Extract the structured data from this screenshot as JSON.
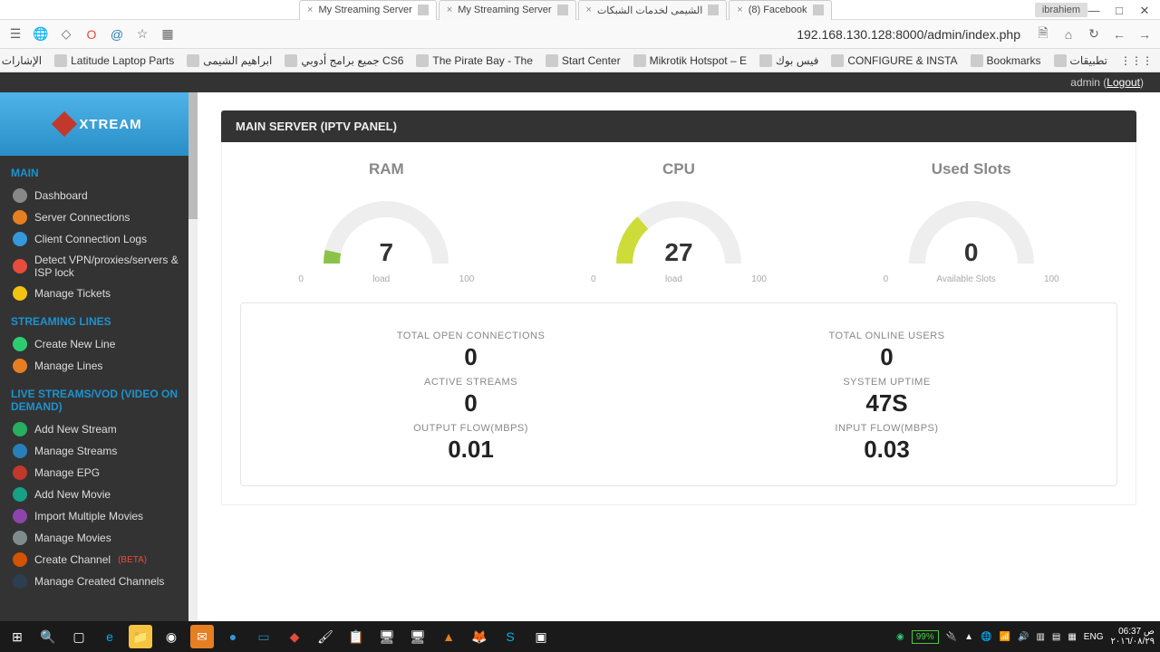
{
  "window": {
    "user_badge": "ibrahiem",
    "tabs": [
      {
        "title": "My Streaming Server",
        "active": true
      },
      {
        "title": "My Streaming Server",
        "active": false
      },
      {
        "title": "الشيمى لخدمات الشبكات",
        "active": false
      },
      {
        "title": "(8) Facebook",
        "active": false
      }
    ]
  },
  "browser": {
    "url": "192.168.130.128:8000/admin/index.php"
  },
  "bookmarks": [
    "تطبيقات",
    "Bookmarks",
    "CONFIGURE & INSTA",
    "فيس بوك",
    "Mikrotik Hotspot – E",
    "Start Center",
    "The Pirate Bay - The",
    "جميع برامج أدوبي CS6",
    "ابراهيم الشيمى",
    "Latitude Laptop Parts",
    "الإشارات الأخرى"
  ],
  "adminbar": {
    "user": "admin",
    "logout": "Logout"
  },
  "sidebar": {
    "logo": "XTREAM",
    "sections": [
      {
        "title": "MAIN",
        "items": [
          {
            "label": "Dashboard",
            "ic": "#888"
          },
          {
            "label": "Server Connections",
            "ic": "#e67e22"
          },
          {
            "label": "Client Connection Logs",
            "ic": "#3498db"
          },
          {
            "label": "Detect VPN/proxies/servers & ISP lock",
            "ic": "#e74c3c"
          },
          {
            "label": "Manage Tickets",
            "ic": "#f1c40f"
          }
        ]
      },
      {
        "title": "STREAMING LINES",
        "items": [
          {
            "label": "Create New Line",
            "ic": "#2ecc71"
          },
          {
            "label": "Manage Lines",
            "ic": "#e67e22"
          }
        ]
      },
      {
        "title": "LIVE STREAMS/VOD (VIDEO ON DEMAND)",
        "items": [
          {
            "label": "Add New Stream",
            "ic": "#27ae60"
          },
          {
            "label": "Manage Streams",
            "ic": "#2980b9"
          },
          {
            "label": "Manage EPG",
            "ic": "#c0392b"
          },
          {
            "label": "Add New Movie",
            "ic": "#16a085"
          },
          {
            "label": "Import Multiple Movies",
            "ic": "#8e44ad"
          },
          {
            "label": "Manage Movies",
            "ic": "#7f8c8d"
          },
          {
            "label": "Create Channel",
            "ic": "#d35400",
            "beta": "(BETA)"
          },
          {
            "label": "Manage Created Channels",
            "ic": "#2c3e50"
          }
        ]
      }
    ]
  },
  "panel": {
    "title": "MAIN SERVER (IPTV PANEL)",
    "gauges": [
      {
        "title": "RAM",
        "value": "7",
        "sub": "load",
        "min": "0",
        "max": "100",
        "pct": 7,
        "color": "#8bc34a"
      },
      {
        "title": "CPU",
        "value": "27",
        "sub": "load",
        "min": "0",
        "max": "100",
        "pct": 27,
        "color": "#cddc39"
      },
      {
        "title": "Used Slots",
        "value": "0",
        "sub": "Available Slots",
        "min": "0",
        "max": "100",
        "pct": 0,
        "color": "#eee"
      }
    ],
    "stats_left": [
      {
        "label": "TOTAL OPEN CONNECTIONS",
        "val": "0"
      },
      {
        "label": "ACTIVE STREAMS",
        "val": "0"
      },
      {
        "label": "OUTPUT FLOW(MBPS)",
        "val": "0.01"
      }
    ],
    "stats_right": [
      {
        "label": "TOTAL ONLINE USERS",
        "val": "0"
      },
      {
        "label": "SYSTEM UPTIME",
        "val": "47S"
      },
      {
        "label": "INPUT FLOW(MBPS)",
        "val": "0.03"
      }
    ]
  },
  "taskbar": {
    "battery": "99%",
    "lang": "ENG",
    "time": "06:37 ص",
    "date": "٢٠١٦/٠٨/٢٩"
  },
  "chart_data": [
    {
      "type": "gauge",
      "title": "RAM",
      "value": 7,
      "min": 0,
      "max": 100,
      "sub": "load"
    },
    {
      "type": "gauge",
      "title": "CPU",
      "value": 27,
      "min": 0,
      "max": 100,
      "sub": "load"
    },
    {
      "type": "gauge",
      "title": "Used Slots",
      "value": 0,
      "min": 0,
      "max": 100,
      "sub": "Available Slots"
    }
  ]
}
